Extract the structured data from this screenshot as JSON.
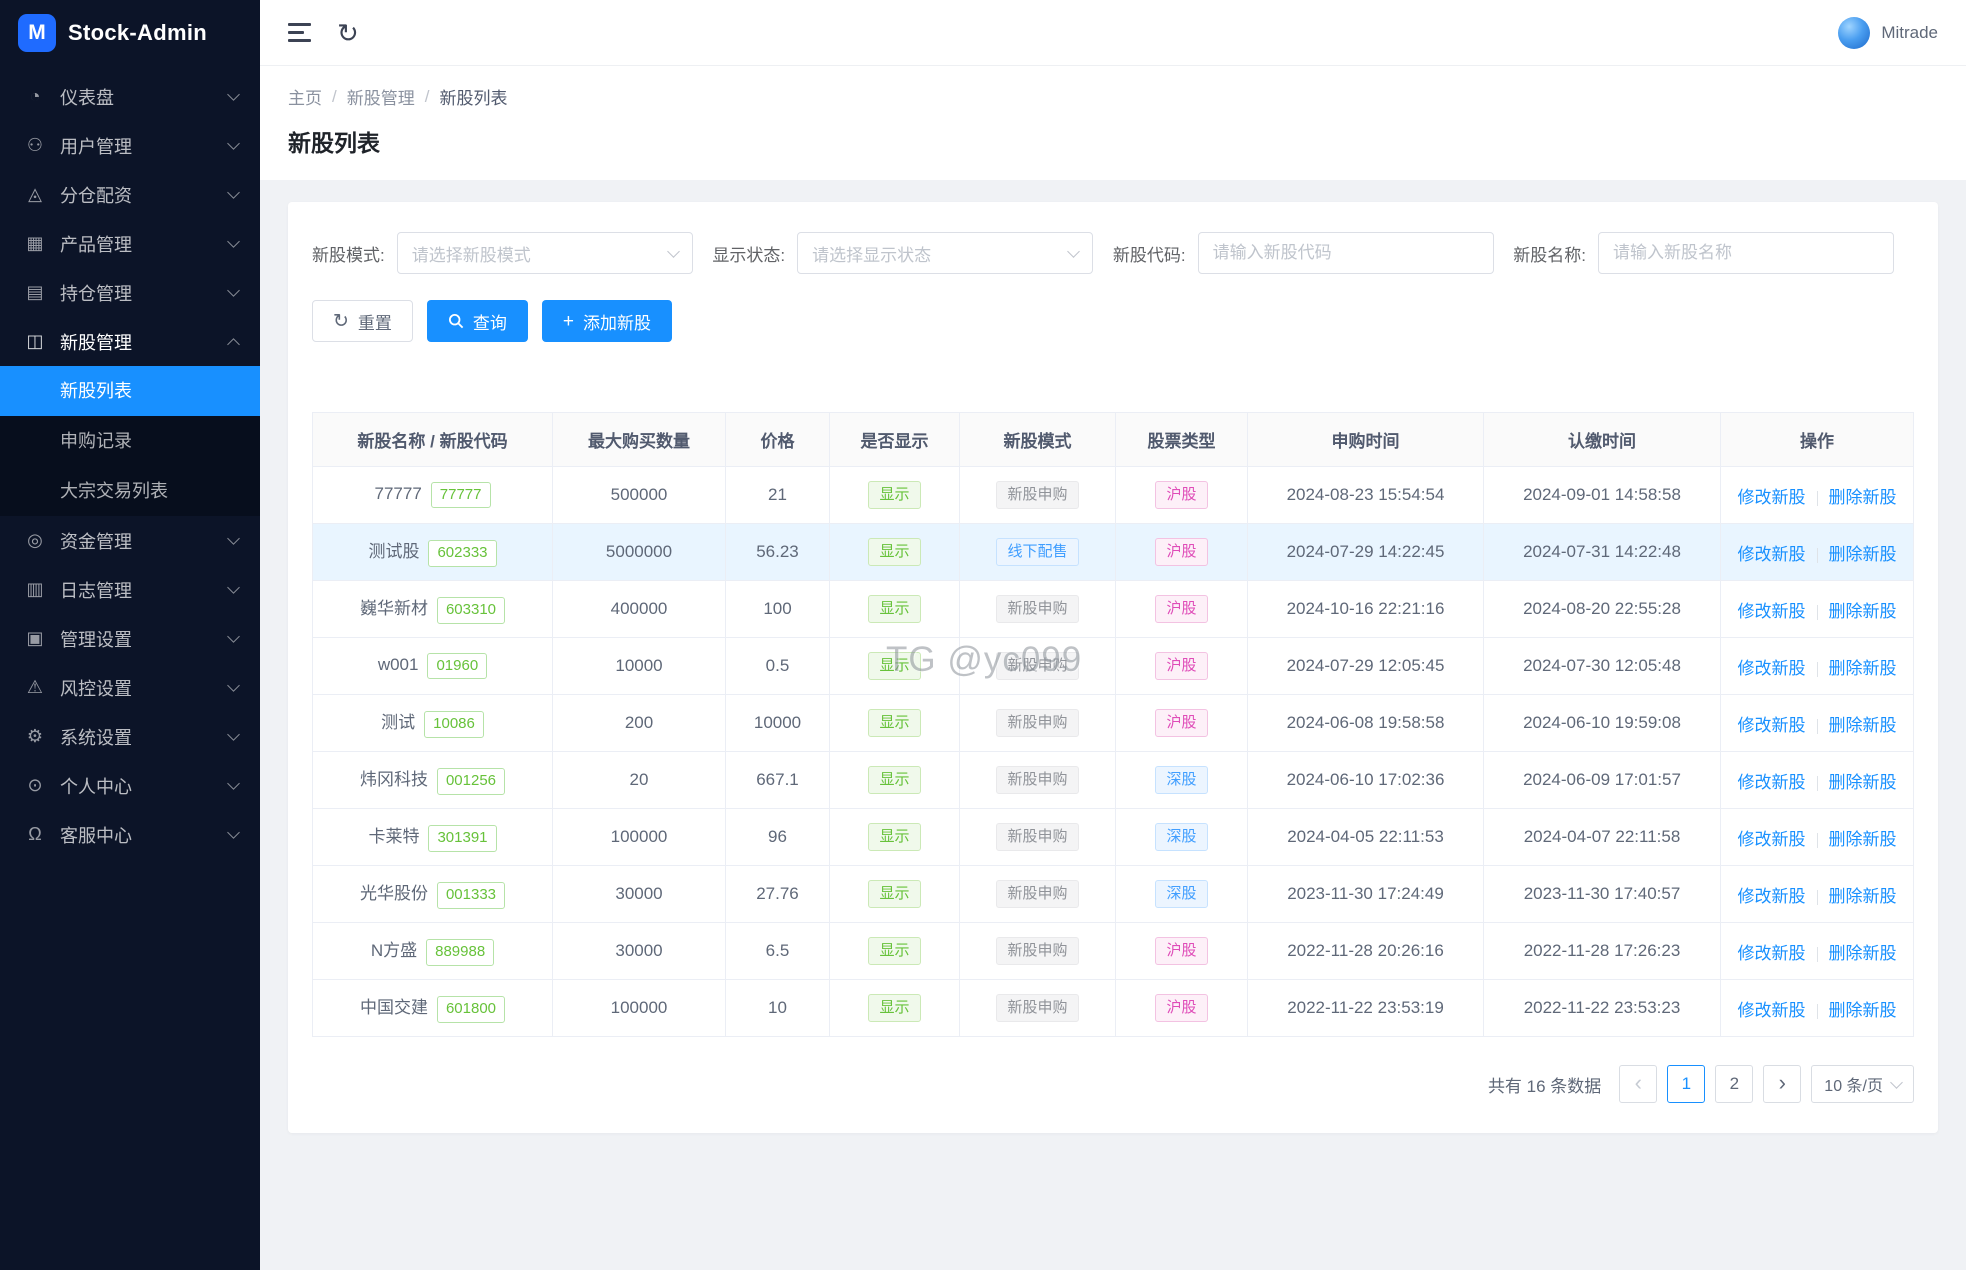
{
  "app": {
    "name": "Stock-Admin",
    "logo_letter": "M",
    "user": "Mitrade"
  },
  "sidebar": {
    "items": [
      {
        "id": "dashboard",
        "icon": "dashboard",
        "label": "仪表盘",
        "chevron": "down"
      },
      {
        "id": "user-management",
        "icon": "users",
        "label": "用户管理",
        "chevron": "down"
      },
      {
        "id": "allocation",
        "icon": "allocation",
        "label": "分仓配资",
        "chevron": "down"
      },
      {
        "id": "product-management",
        "icon": "products",
        "label": "产品管理",
        "chevron": "down"
      },
      {
        "id": "position-management",
        "icon": "positions",
        "label": "持仓管理",
        "chevron": "down"
      },
      {
        "id": "ipo-management",
        "icon": "ipo",
        "label": "新股管理",
        "chevron": "up",
        "active": true,
        "expanded": true,
        "children": [
          {
            "id": "ipo-list",
            "label": "新股列表",
            "active": true
          },
          {
            "id": "subscription-records",
            "label": "申购记录",
            "active": false
          },
          {
            "id": "block-trade-list",
            "label": "大宗交易列表",
            "active": false
          }
        ]
      },
      {
        "id": "fund-management",
        "icon": "funds",
        "label": "资金管理",
        "chevron": "down"
      },
      {
        "id": "log-management",
        "icon": "logs",
        "label": "日志管理",
        "chevron": "down"
      },
      {
        "id": "admin-settings",
        "icon": "admin",
        "label": "管理设置",
        "chevron": "down"
      },
      {
        "id": "risk-settings",
        "icon": "risk",
        "label": "风控设置",
        "chevron": "down"
      },
      {
        "id": "system-settings",
        "icon": "system",
        "label": "系统设置",
        "chevron": "down"
      },
      {
        "id": "personal-center",
        "icon": "profile",
        "label": "个人中心",
        "chevron": "down"
      },
      {
        "id": "support-center",
        "icon": "support",
        "label": "客服中心",
        "chevron": "down"
      }
    ]
  },
  "breadcrumb": {
    "separator": "/",
    "items": [
      "主页",
      "新股管理",
      "新股列表"
    ]
  },
  "page": {
    "title": "新股列表"
  },
  "filters": {
    "mode": {
      "label": "新股模式:",
      "placeholder": "请选择新股模式"
    },
    "status": {
      "label": "显示状态:",
      "placeholder": "请选择显示状态"
    },
    "code": {
      "label": "新股代码:",
      "placeholder": "请输入新股代码"
    },
    "name": {
      "label": "新股名称:",
      "placeholder": "请输入新股名称"
    }
  },
  "toolbar": {
    "reset": "重置",
    "search": "查询",
    "add": "添加新股"
  },
  "table": {
    "columns": [
      "新股名称 / 新股代码",
      "最大购买数量",
      "价格",
      "是否显示",
      "新股模式",
      "股票类型",
      "申购时间",
      "认缴时间",
      "操作"
    ],
    "actions": {
      "edit": "修改新股",
      "delete": "删除新股"
    },
    "rows": [
      {
        "name": "77777",
        "code": "77777",
        "max_qty": "500000",
        "price": "21",
        "display": "显示",
        "mode": "新股申购",
        "mode_style": "info",
        "stock_type": "沪股",
        "type_style": "magenta",
        "subscribe_time": "2024-08-23 15:54:54",
        "pay_time": "2024-09-01 14:58:58",
        "highlight": false
      },
      {
        "name": "测试股",
        "code": "602333",
        "max_qty": "5000000",
        "price": "56.23",
        "display": "显示",
        "mode": "线下配售",
        "mode_style": "blue",
        "stock_type": "沪股",
        "type_style": "magenta",
        "subscribe_time": "2024-07-29 14:22:45",
        "pay_time": "2024-07-31 14:22:48",
        "highlight": true
      },
      {
        "name": "巍华新材",
        "code": "603310",
        "max_qty": "400000",
        "price": "100",
        "display": "显示",
        "mode": "新股申购",
        "mode_style": "info",
        "stock_type": "沪股",
        "type_style": "magenta",
        "subscribe_time": "2024-10-16 22:21:16",
        "pay_time": "2024-08-20 22:55:28",
        "highlight": false
      },
      {
        "name": "w001",
        "code": "01960",
        "max_qty": "10000",
        "price": "0.5",
        "display": "显示",
        "mode": "新股申购",
        "mode_style": "info",
        "stock_type": "沪股",
        "type_style": "magenta",
        "subscribe_time": "2024-07-29 12:05:45",
        "pay_time": "2024-07-30 12:05:48",
        "highlight": false
      },
      {
        "name": "测试",
        "code": "10086",
        "max_qty": "200",
        "price": "10000",
        "display": "显示",
        "mode": "新股申购",
        "mode_style": "info",
        "stock_type": "沪股",
        "type_style": "magenta",
        "subscribe_time": "2024-06-08 19:58:58",
        "pay_time": "2024-06-10 19:59:08",
        "highlight": false
      },
      {
        "name": "炜冈科技",
        "code": "001256",
        "max_qty": "20",
        "price": "667.1",
        "display": "显示",
        "mode": "新股申购",
        "mode_style": "info",
        "stock_type": "深股",
        "type_style": "blue",
        "subscribe_time": "2024-06-10 17:02:36",
        "pay_time": "2024-06-09 17:01:57",
        "highlight": false
      },
      {
        "name": "卡莱特",
        "code": "301391",
        "max_qty": "100000",
        "price": "96",
        "display": "显示",
        "mode": "新股申购",
        "mode_style": "info",
        "stock_type": "深股",
        "type_style": "blue",
        "subscribe_time": "2024-04-05 22:11:53",
        "pay_time": "2024-04-07 22:11:58",
        "highlight": false
      },
      {
        "name": "光华股份",
        "code": "001333",
        "max_qty": "30000",
        "price": "27.76",
        "display": "显示",
        "mode": "新股申购",
        "mode_style": "info",
        "stock_type": "深股",
        "type_style": "blue",
        "subscribe_time": "2023-11-30 17:24:49",
        "pay_time": "2023-11-30 17:40:57",
        "highlight": false
      },
      {
        "name": "N方盛",
        "code": "889988",
        "max_qty": "30000",
        "price": "6.5",
        "display": "显示",
        "mode": "新股申购",
        "mode_style": "info",
        "stock_type": "沪股",
        "type_style": "magenta",
        "subscribe_time": "2022-11-28 20:26:16",
        "pay_time": "2022-11-28 17:26:23",
        "highlight": false
      },
      {
        "name": "中国交建",
        "code": "601800",
        "max_qty": "100000",
        "price": "10",
        "display": "显示",
        "mode": "新股申购",
        "mode_style": "info",
        "stock_type": "沪股",
        "type_style": "magenta",
        "subscribe_time": "2022-11-22 23:53:19",
        "pay_time": "2022-11-22 23:53:23",
        "highlight": false
      }
    ]
  },
  "pagination": {
    "total": "共有 16 条数据",
    "pages": [
      "1",
      "2"
    ],
    "active_page": "1",
    "page_size": "10 条/页"
  },
  "watermark": "TG @yc099",
  "colors": {
    "primary": "#1890ff",
    "sidebar_bg": "#0c1428",
    "highlight_row": "#e9f5ff"
  }
}
